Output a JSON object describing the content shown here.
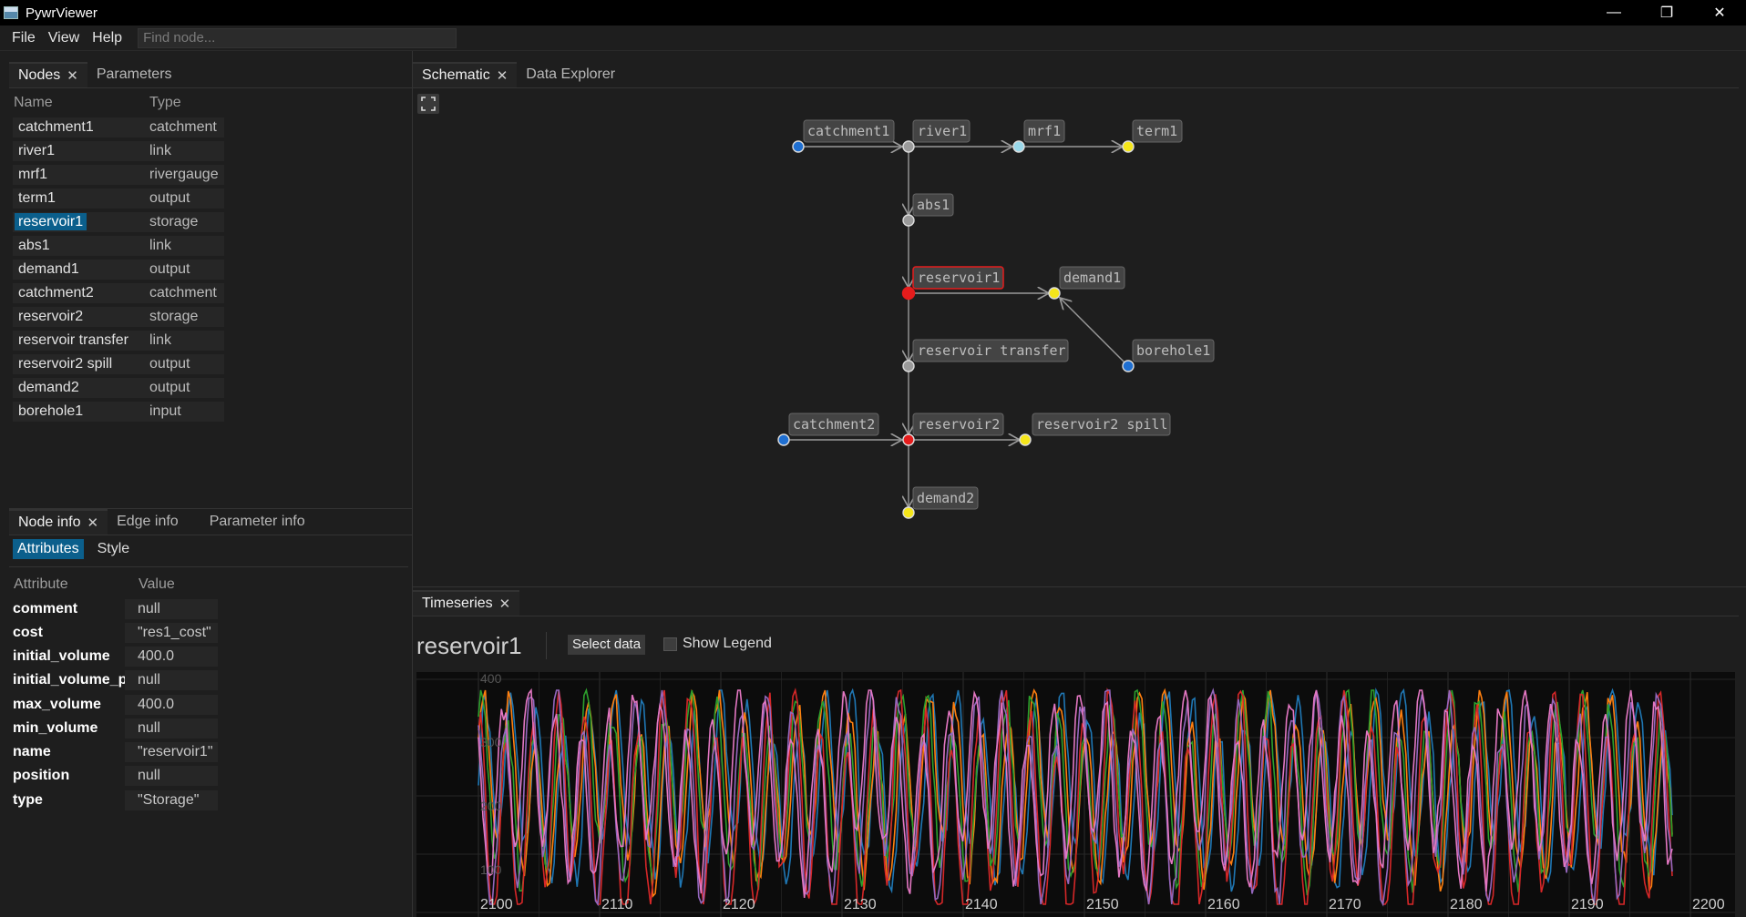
{
  "window": {
    "title": "PywrViewer",
    "minimize": "—",
    "restore": "❐",
    "close": "✕"
  },
  "menu": {
    "file": "File",
    "view": "View",
    "help": "Help",
    "search_placeholder": "Find node..."
  },
  "left_tabs": {
    "nodes": "Nodes",
    "parameters": "Parameters"
  },
  "nodes_table": {
    "headers": {
      "name": "Name",
      "type": "Type"
    },
    "rows": [
      {
        "name": "catchment1",
        "type": "catchment"
      },
      {
        "name": "river1",
        "type": "link"
      },
      {
        "name": "mrf1",
        "type": "rivergauge"
      },
      {
        "name": "term1",
        "type": "output"
      },
      {
        "name": "reservoir1",
        "type": "storage"
      },
      {
        "name": "abs1",
        "type": "link"
      },
      {
        "name": "demand1",
        "type": "output"
      },
      {
        "name": "catchment2",
        "type": "catchment"
      },
      {
        "name": "reservoir2",
        "type": "storage"
      },
      {
        "name": "reservoir transfer",
        "type": "link"
      },
      {
        "name": "reservoir2 spill",
        "type": "output"
      },
      {
        "name": "demand2",
        "type": "output"
      },
      {
        "name": "borehole1",
        "type": "input"
      }
    ],
    "selected": "reservoir1"
  },
  "info_tabs": {
    "node_info": "Node info",
    "edge_info": "Edge info",
    "parameter_info": "Parameter info"
  },
  "info_subtabs": {
    "attributes": "Attributes",
    "style": "Style"
  },
  "attributes": {
    "headers": {
      "attribute": "Attribute",
      "value": "Value"
    },
    "rows": [
      {
        "attribute": "comment",
        "value": "null"
      },
      {
        "attribute": "cost",
        "value": "\"res1_cost\""
      },
      {
        "attribute": "initial_volume",
        "value": "400.0"
      },
      {
        "attribute": "initial_volume_pc",
        "value": "null"
      },
      {
        "attribute": "max_volume",
        "value": "400.0"
      },
      {
        "attribute": "min_volume",
        "value": "null"
      },
      {
        "attribute": "name",
        "value": "\"reservoir1\""
      },
      {
        "attribute": "position",
        "value": "null"
      },
      {
        "attribute": "type",
        "value": "\"Storage\""
      }
    ]
  },
  "main_tabs": {
    "schematic": "Schematic",
    "data_explorer": "Data Explorer"
  },
  "schematic": {
    "nodes": [
      {
        "label": "catchment1",
        "color": "#1f6fd1"
      },
      {
        "label": "river1",
        "color": "#9a9a9a"
      },
      {
        "label": "mrf1",
        "color": "#9ad8ea"
      },
      {
        "label": "term1",
        "color": "#f5e61a"
      },
      {
        "label": "abs1",
        "color": "#9a9a9a"
      },
      {
        "label": "reservoir1",
        "color": "#e51c1c"
      },
      {
        "label": "demand1",
        "color": "#f5e61a"
      },
      {
        "label": "reservoir transfer",
        "color": "#9a9a9a"
      },
      {
        "label": "borehole1",
        "color": "#1f6fd1"
      },
      {
        "label": "catchment2",
        "color": "#1f6fd1"
      },
      {
        "label": "reservoir2",
        "color": "#e51c1c"
      },
      {
        "label": "reservoir2 spill",
        "color": "#f5e61a"
      },
      {
        "label": "demand2",
        "color": "#f5e61a"
      }
    ]
  },
  "timeseries": {
    "tab": "Timeseries",
    "title": "reservoir1",
    "select_data": "Select data",
    "show_legend": "Show Legend"
  },
  "chart_data": {
    "type": "line",
    "x_ticks": [
      "2100",
      "2110",
      "2120",
      "2130",
      "2140",
      "2150",
      "2160",
      "2170",
      "2180",
      "2190",
      "2200"
    ],
    "y_ticks": [
      "400",
      "300",
      "200",
      "100"
    ],
    "xlim": [
      2100,
      2200
    ],
    "ylim": [
      0,
      400
    ],
    "series_colors": [
      "#1f77b4",
      "#ff7f0e",
      "#2ca02c",
      "#d62728",
      "#9467bd",
      "#e377c2"
    ],
    "series_count": 6,
    "grid": true,
    "legend": "hidden"
  },
  "colors": {
    "accent": "#0b5f8c",
    "background": "#1e1e1e"
  }
}
